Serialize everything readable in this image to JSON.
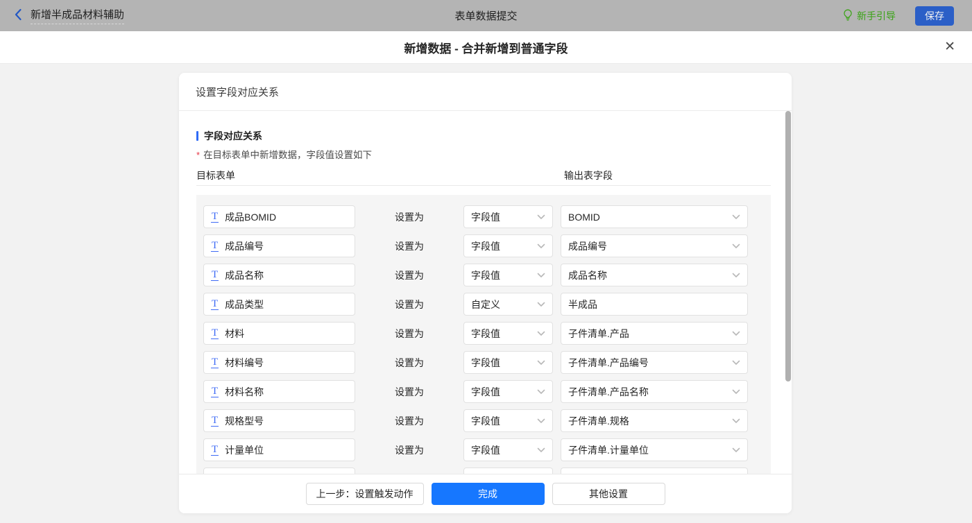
{
  "topbar": {
    "app_title": "新增半成品材料辅助",
    "center_title": "表单数据提交",
    "guide_label": "新手引导",
    "save_label": "保存"
  },
  "modal": {
    "title": "新增数据 - 合并新增到普通字段",
    "close_glyph": "✕"
  },
  "card": {
    "header_title": "设置字段对应关系",
    "section_title": "字段对应关系",
    "required_note": "在目标表单中新增数据，字段值设置如下",
    "col_left": "目标表单",
    "col_right": "输出表字段",
    "set_as_label": "设置为",
    "rows": [
      {
        "field": "成品BOMID",
        "mode": "字段值",
        "value": "BOMID",
        "value_dropdown": true,
        "partial": false
      },
      {
        "field": "成品编号",
        "mode": "字段值",
        "value": "成品编号",
        "value_dropdown": true,
        "partial": false
      },
      {
        "field": "成品名称",
        "mode": "字段值",
        "value": "成品名称",
        "value_dropdown": true,
        "partial": false
      },
      {
        "field": "成品类型",
        "mode": "自定义",
        "value": "半成品",
        "value_dropdown": false,
        "partial": false
      },
      {
        "field": "材料",
        "mode": "字段值",
        "value": "子件清单.产品",
        "value_dropdown": true,
        "partial": false
      },
      {
        "field": "材料编号",
        "mode": "字段值",
        "value": "子件清单.产品编号",
        "value_dropdown": true,
        "partial": false
      },
      {
        "field": "材料名称",
        "mode": "字段值",
        "value": "子件清单.产品名称",
        "value_dropdown": true,
        "partial": false
      },
      {
        "field": "规格型号",
        "mode": "字段值",
        "value": "子件清单.规格",
        "value_dropdown": true,
        "partial": false
      },
      {
        "field": "计量单位",
        "mode": "字段值",
        "value": "子件清单.计量单位",
        "value_dropdown": true,
        "partial": false
      },
      {
        "field": "",
        "mode": "",
        "value": "",
        "value_dropdown": false,
        "partial": true
      }
    ]
  },
  "footer": {
    "prev_label": "上一步：设置触发动作",
    "done_label": "完成",
    "other_label": "其他设置"
  },
  "colors": {
    "topbar_bg": "#b4b4b4",
    "accent_blue": "#2e6bf6",
    "primary_button_blue": "#1677ff",
    "save_button_blue": "#2b5fc7",
    "guide_green": "#3aa315",
    "required_red": "#e63746",
    "rows_bg": "#f5f5f5",
    "page_bg": "#f2f2f2"
  }
}
